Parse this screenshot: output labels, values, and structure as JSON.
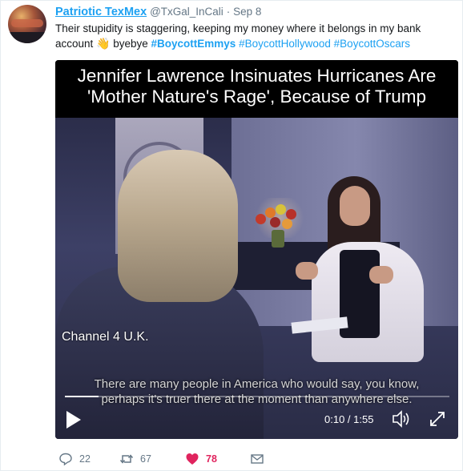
{
  "tweet": {
    "display_name": "Patriotic TexMex",
    "handle": "@TxGal_InCali",
    "separator": "·",
    "date": "Sep 8",
    "text_part1": "Their stupidity is staggering, keeping my money where it belongs in my bank account ",
    "emoji": "👋",
    "text_part2": " byebye ",
    "hashtags": [
      "#BoycottEmmys",
      "#BoycottHollywood",
      "#BoycottOscars"
    ]
  },
  "video": {
    "title_line1": "Jennifer Lawrence Insinuates Hurricanes Are",
    "title_line2": "'Mother Nature's Rage', Because of Trump",
    "channel_label": "Channel 4 U.K.",
    "subtitle_line1": "There are many people in America who would say, you know,",
    "subtitle_line2": "perhaps it's truer there at the moment than anywhere else.",
    "time": "0:10 / 1:55",
    "progress_fraction": 0.087
  },
  "actions": {
    "reply_count": "22",
    "retweet_count": "67",
    "like_count": "78"
  },
  "colors": {
    "link_blue": "#1da1f2",
    "like_red": "#e0245e",
    "muted": "#657786"
  },
  "icons": [
    "reply-icon",
    "retweet-icon",
    "heart-icon",
    "envelope-icon",
    "play-icon",
    "volume-icon",
    "fullscreen-icon"
  ]
}
